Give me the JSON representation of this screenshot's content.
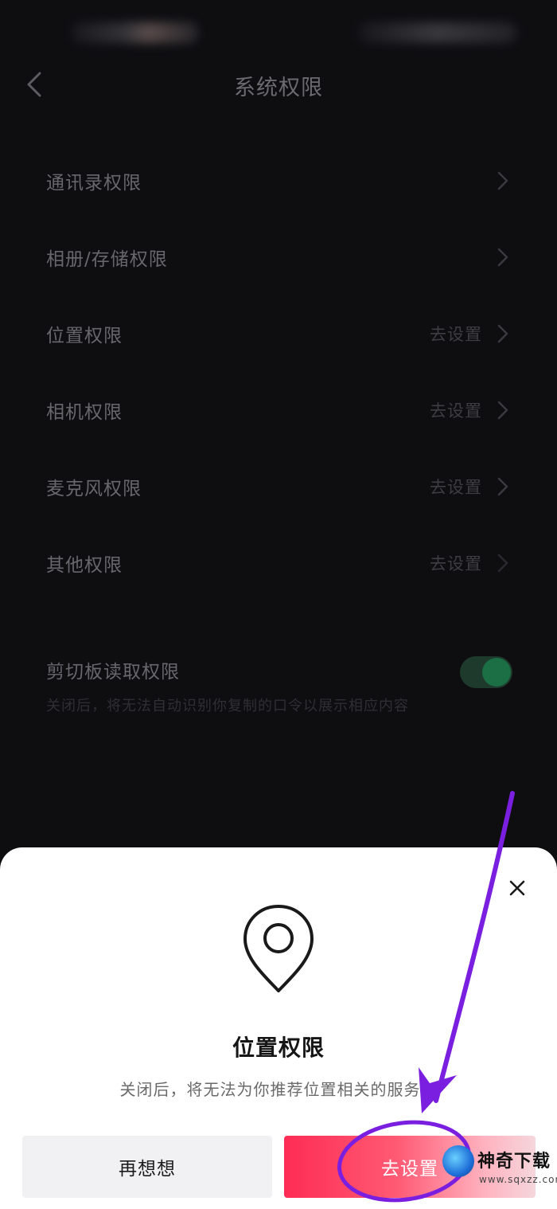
{
  "nav": {
    "title": "系统权限"
  },
  "permissions": [
    {
      "label": "通讯录权限",
      "action": ""
    },
    {
      "label": "相册/存储权限",
      "action": ""
    },
    {
      "label": "位置权限",
      "action": "去设置"
    },
    {
      "label": "相机权限",
      "action": "去设置"
    },
    {
      "label": "麦克风权限",
      "action": "去设置"
    },
    {
      "label": "其他权限",
      "action": "去设置"
    }
  ],
  "clipboard": {
    "label": "剪切板读取权限",
    "description": "关闭后，将无法自动识别你复制的口令以展示相应内容",
    "enabled": true
  },
  "sheet": {
    "icon": "location-pin-icon",
    "title": "位置权限",
    "description": "关闭后，将无法为你推荐位置相关的服务。",
    "cancel_label": "再想想",
    "confirm_label": "去设置"
  },
  "watermark": {
    "name": "神奇下载",
    "url": "www.sqxzz.com"
  },
  "colors": {
    "accent": "#fe2c55",
    "annotation": "#7a1fe0",
    "toggle_on": "#1c6e45"
  }
}
